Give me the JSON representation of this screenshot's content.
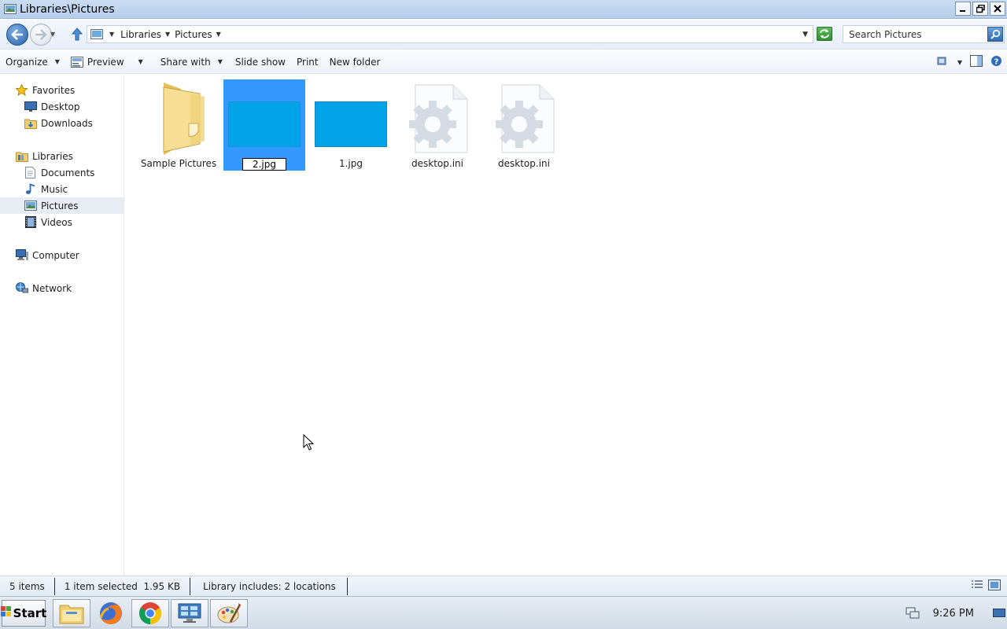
{
  "window": {
    "title": "Libraries\\Pictures"
  },
  "address": {
    "crumbs": [
      "Libraries",
      "Pictures"
    ],
    "search_placeholder": "Search Pictures"
  },
  "toolbar": {
    "organize": "Organize",
    "preview": "Preview",
    "share_with": "Share with",
    "slide_show": "Slide show",
    "print": "Print",
    "new_folder": "New folder"
  },
  "nav": {
    "favorites": "Favorites",
    "desktop": "Desktop",
    "downloads": "Downloads",
    "libraries": "Libraries",
    "documents": "Documents",
    "music": "Music",
    "pictures": "Pictures",
    "videos": "Videos",
    "computer": "Computer",
    "network": "Network"
  },
  "items": [
    {
      "name": "Sample Pictures",
      "type": "folder"
    },
    {
      "name": "2.jpg",
      "type": "image",
      "selected": true,
      "renaming": true
    },
    {
      "name": "1.jpg",
      "type": "image"
    },
    {
      "name": "desktop.ini",
      "type": "config"
    },
    {
      "name": "desktop.ini",
      "type": "config"
    }
  ],
  "status": {
    "count": "5 items",
    "selection": "1 item selected  1.95 KB",
    "library": "Library includes: 2 locations"
  },
  "taskbar": {
    "start": "Start",
    "clock": "9:26 PM"
  },
  "colors": {
    "selection": "#3399ff",
    "image_thumb": "#00a2e8",
    "folder": "#f2d27a"
  }
}
